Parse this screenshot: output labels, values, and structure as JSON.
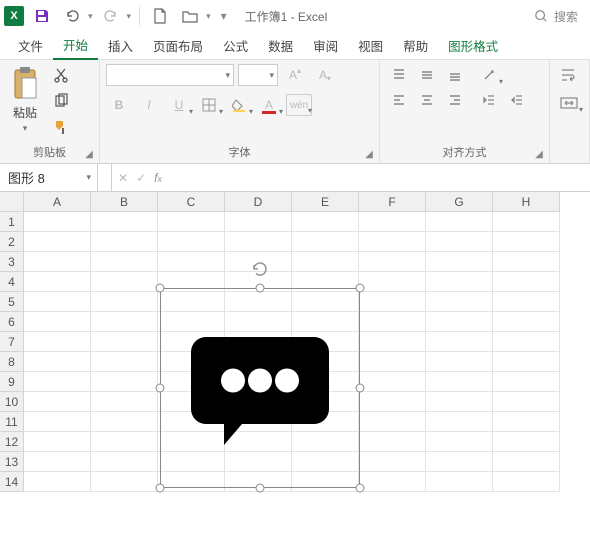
{
  "title": "工作簿1 - Excel",
  "search_placeholder": "搜索",
  "tabs": {
    "file": "文件",
    "home": "开始",
    "insert": "插入",
    "page_layout": "页面布局",
    "formulas": "公式",
    "data": "数据",
    "review": "审阅",
    "view": "视图",
    "help": "帮助",
    "shape_format": "图形格式"
  },
  "groups": {
    "clipboard": {
      "label": "剪贴板",
      "paste": "粘贴"
    },
    "font": {
      "label": "字体"
    },
    "align": {
      "label": "对齐方式"
    }
  },
  "namebox_value": "图形 8",
  "formula_value": "",
  "columns": [
    "A",
    "B",
    "C",
    "D",
    "E",
    "F",
    "G",
    "H"
  ],
  "rows": [
    "1",
    "2",
    "3",
    "4",
    "5",
    "6",
    "7",
    "8",
    "9",
    "10",
    "11",
    "12",
    "13",
    "14"
  ]
}
